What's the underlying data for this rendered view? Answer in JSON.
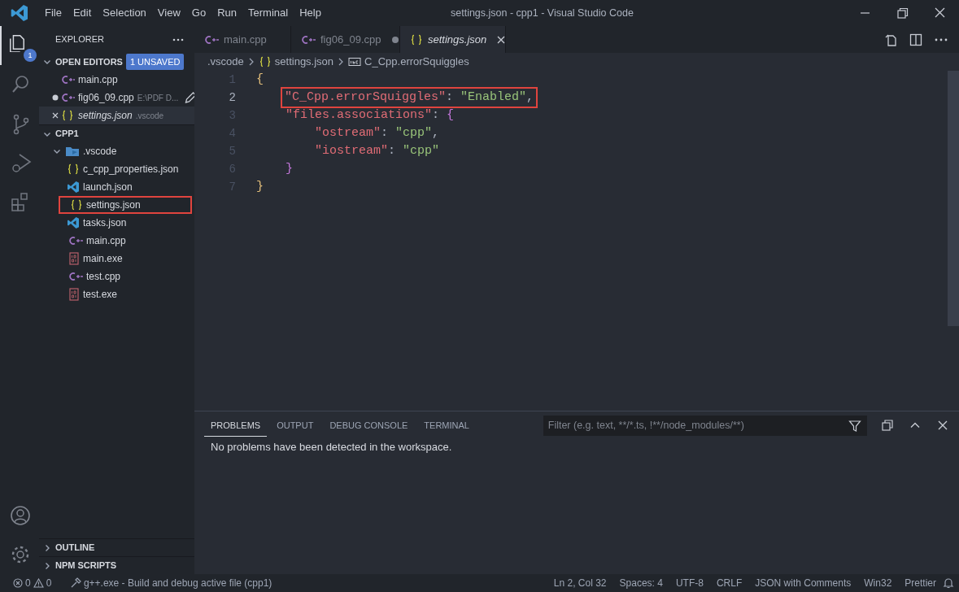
{
  "window": {
    "title": "settings.json - cpp1 - Visual Studio Code",
    "menu": [
      "File",
      "Edit",
      "Selection",
      "View",
      "Go",
      "Run",
      "Terminal",
      "Help"
    ]
  },
  "activity_bar": {
    "items": [
      {
        "kind": "files",
        "selected": true,
        "badge": "1"
      },
      {
        "kind": "search",
        "selected": false
      },
      {
        "kind": "source-control",
        "selected": false
      },
      {
        "kind": "debug",
        "selected": false
      },
      {
        "kind": "extensions",
        "selected": false
      }
    ],
    "bottom": [
      {
        "kind": "account"
      },
      {
        "kind": "settings"
      }
    ]
  },
  "sidebar": {
    "title": "EXPLORER",
    "open_editors": {
      "title": "OPEN EDITORS",
      "badge": "1 UNSAVED",
      "expanded": true,
      "items": [
        {
          "name": "main.cpp",
          "kind": "cpp",
          "modified": false,
          "closable": false,
          "selected": false,
          "italic": false
        },
        {
          "name": "fig06_09.cpp",
          "kind": "cpp",
          "description": "E:\\PDF D...",
          "modified": true,
          "closable": false,
          "selected": false,
          "italic": false
        },
        {
          "name": "settings.json",
          "kind": "json",
          "description": ".vscode",
          "modified": false,
          "closable": true,
          "selected": true,
          "italic": true
        }
      ]
    },
    "folder": {
      "title": "CPP1",
      "expanded": true,
      "items": [
        {
          "name": ".vscode",
          "kind": "folder",
          "expanded": true,
          "boxed": false,
          "children": [
            {
              "name": "c_cpp_properties.json",
              "kind": "json",
              "boxed": false
            },
            {
              "name": "launch.json",
              "kind": "vscode",
              "boxed": false
            },
            {
              "name": "settings.json",
              "kind": "json",
              "boxed": true
            },
            {
              "name": "tasks.json",
              "kind": "vscode",
              "boxed": false
            }
          ]
        },
        {
          "name": "main.cpp",
          "kind": "cpp",
          "boxed": false
        },
        {
          "name": "main.exe",
          "kind": "exe",
          "boxed": false
        },
        {
          "name": "test.cpp",
          "kind": "cpp",
          "boxed": false
        },
        {
          "name": "test.exe",
          "kind": "exe",
          "boxed": false
        }
      ]
    },
    "sections": [
      {
        "title": "OUTLINE",
        "expanded": false
      },
      {
        "title": "NPM SCRIPTS",
        "expanded": false
      }
    ]
  },
  "tabs": [
    {
      "label": "main.cpp",
      "kind": "cpp",
      "selected": false,
      "modified": false,
      "italic": false
    },
    {
      "label": "fig06_09.cpp",
      "kind": "cpp",
      "selected": false,
      "modified": true,
      "italic": false
    },
    {
      "label": "settings.json",
      "kind": "json",
      "selected": true,
      "modified": false,
      "italic": true
    }
  ],
  "breadcrumb": [
    {
      "label": ".vscode",
      "kind": "folder"
    },
    {
      "label": "settings.json",
      "kind": "json"
    },
    {
      "label": "C_Cpp.errorSquiggles",
      "kind": "symbol"
    }
  ],
  "editor": {
    "lines": [
      {
        "number": "1",
        "active": false,
        "boxed": false,
        "tokens": [
          {
            "text": "{",
            "kind": "brace"
          }
        ],
        "children": [
          {
            "number": "2",
            "active": true,
            "boxed": true,
            "tokens": [
              {
                "text": "\"C_Cpp.errorSquiggles\"",
                "kind": "key"
              },
              {
                "text": ": ",
                "kind": "punct"
              },
              {
                "text": "\"Enabled\"",
                "kind": "string"
              },
              {
                "text": ",",
                "kind": "punct"
              }
            ]
          },
          {
            "number": "3",
            "active": false,
            "boxed": false,
            "tokens": [
              {
                "text": "\"files.associations\"",
                "kind": "key"
              },
              {
                "text": ": ",
                "kind": "punct"
              },
              {
                "text": "{",
                "kind": "brace2"
              }
            ],
            "children": [
              {
                "number": "4",
                "active": false,
                "boxed": false,
                "tokens": [
                  {
                    "text": "\"ostream\"",
                    "kind": "key"
                  },
                  {
                    "text": ": ",
                    "kind": "punct"
                  },
                  {
                    "text": "\"cpp\"",
                    "kind": "string"
                  },
                  {
                    "text": ",",
                    "kind": "punct"
                  }
                ]
              },
              {
                "number": "5",
                "active": false,
                "boxed": false,
                "tokens": [
                  {
                    "text": "\"iostream\"",
                    "kind": "key"
                  },
                  {
                    "text": ": ",
                    "kind": "punct"
                  },
                  {
                    "text": "\"cpp\"",
                    "kind": "string"
                  }
                ]
              }
            ]
          },
          {
            "number": "6",
            "active": false,
            "boxed": false,
            "tokens": [
              {
                "text": "}",
                "kind": "brace2"
              }
            ]
          }
        ]
      },
      {
        "number": "7",
        "active": false,
        "boxed": false,
        "tokens": [
          {
            "text": "}",
            "kind": "brace"
          }
        ]
      }
    ]
  },
  "panel": {
    "tabs": [
      {
        "label": "PROBLEMS",
        "selected": true
      },
      {
        "label": "OUTPUT",
        "selected": false
      },
      {
        "label": "DEBUG CONSOLE",
        "selected": false
      },
      {
        "label": "TERMINAL",
        "selected": false
      }
    ],
    "filter": {
      "placeholder": "Filter (e.g. text, **/*.ts, !**/node_modules/**)"
    },
    "message": "No problems have been detected in the workspace."
  },
  "status_bar": {
    "errors": "0",
    "warnings": "0",
    "task": "g++.exe - Build and debug active file (cpp1)",
    "right": [
      "Ln 2, Col 32",
      "Spaces: 4",
      "UTF-8",
      "CRLF",
      "JSON with Comments",
      "Win32",
      "Prettier"
    ]
  }
}
